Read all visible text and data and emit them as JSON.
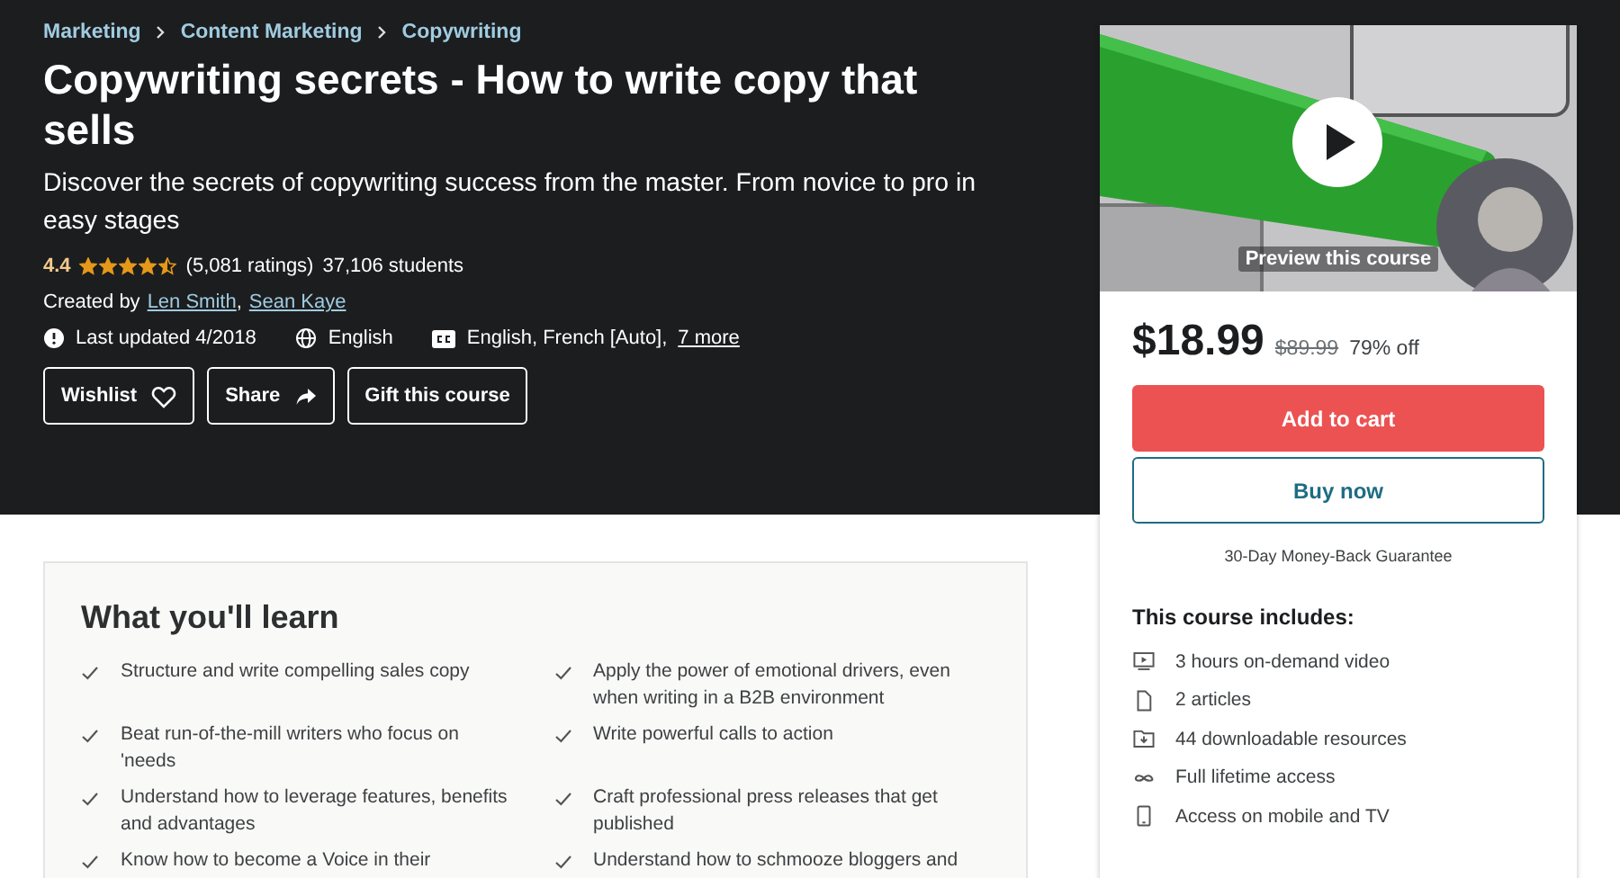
{
  "breadcrumbs": [
    {
      "label": "Marketing"
    },
    {
      "label": "Content Marketing"
    },
    {
      "label": "Copywriting"
    }
  ],
  "title": "Copywriting secrets - How to write copy that sells",
  "subtitle": "Discover the secrets of copywriting success from the master. From novice to pro in easy stages",
  "rating": {
    "value": "4.4",
    "stars": 4.5,
    "ratings": "(5,081 ratings)",
    "students": "37,106 students"
  },
  "created_by": {
    "label": "Created by",
    "authors": [
      {
        "name": "Len Smith",
        "separator": ","
      },
      {
        "name": "Sean Kaye"
      }
    ]
  },
  "meta": {
    "updated": "Last updated 4/2018",
    "language": "English",
    "captions": "English, French [Auto],",
    "more": "7 more"
  },
  "actions": [
    {
      "label": "Wishlist"
    },
    {
      "label": "Share"
    },
    {
      "label": "Gift this course"
    }
  ],
  "preview": {
    "label": "Preview this course"
  },
  "price": {
    "current": "$18.99",
    "original": "$89.99",
    "discount": "79% off"
  },
  "buttons": [
    {
      "label": "Add to cart",
      "kind": "primary"
    },
    {
      "label": "Buy now",
      "kind": "outline"
    }
  ],
  "guarantee": "30-Day Money-Back Guarantee",
  "includes": {
    "title": "This course includes:",
    "items": [
      {
        "text": "3 hours on-demand video"
      },
      {
        "text": "2 articles"
      },
      {
        "text": "44 downloadable resources"
      },
      {
        "text": "Full lifetime access"
      },
      {
        "text": "Access on mobile and TV"
      }
    ]
  },
  "learn": {
    "title": "What you'll learn",
    "items": [
      "Structure and write compelling sales copy",
      "Apply the power of emotional drivers, even when writing in a B2B environment",
      "Beat run-of-the-mill writers who focus on 'needs",
      "Write powerful calls to action",
      "Understand how to leverage features, benefits and advantages",
      "Craft professional press releases that get published",
      "Know how to become a Voice in their",
      "Understand how to schmooze bloggers and"
    ]
  }
}
